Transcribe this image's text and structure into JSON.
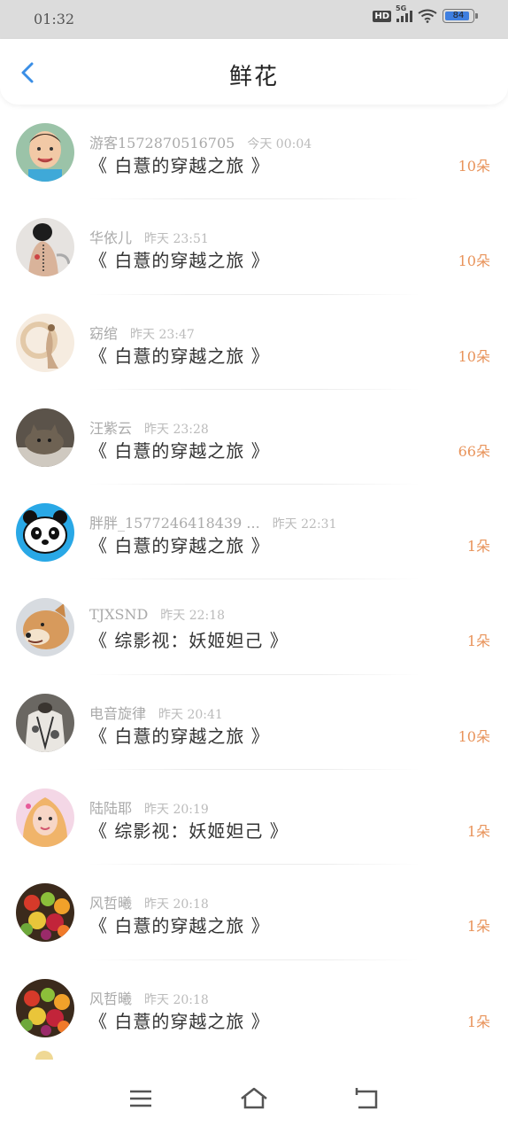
{
  "status_bar": {
    "time": "01:32",
    "hd": "HD",
    "network": "5G",
    "battery": "84"
  },
  "header": {
    "title": "鲜花"
  },
  "rows": [
    {
      "name": "游客1572870516705",
      "time": "今天 00:04",
      "book": "《 白薏的穿越之旅 》",
      "count": "10朵",
      "avatar": "avatar-child-photo"
    },
    {
      "name": "华依儿",
      "time": "昨天 23:51",
      "book": "《 白薏的穿越之旅 》",
      "count": "10朵",
      "avatar": "avatar-tattoo-photo"
    },
    {
      "name": "窈绾",
      "time": "昨天 23:47",
      "book": "《 白薏的穿越之旅 》",
      "count": "10朵",
      "avatar": "avatar-ink-painting"
    },
    {
      "name": "汪紫云",
      "time": "昨天 23:28",
      "book": "《 白薏的穿越之旅 》",
      "count": "66朵",
      "avatar": "avatar-cat-photo"
    },
    {
      "name": "胖胖_1577246418439 ...",
      "time": "昨天 22:31",
      "book": "《 白薏的穿越之旅 》",
      "count": "1朵",
      "avatar": "avatar-panda-cartoon"
    },
    {
      "name": "TJXSND",
      "time": "昨天 22:18",
      "book": "《 综影视：妖姬妲己 》",
      "count": "1朵",
      "avatar": "avatar-shiba-dog"
    },
    {
      "name": "电音旋律",
      "time": "昨天 20:41",
      "book": "《 白薏的穿越之旅 》",
      "count": "10朵",
      "avatar": "avatar-jacket-photo"
    },
    {
      "name": "陆陆耶",
      "time": "昨天 20:19",
      "book": "《 综影视：妖姬妲己 》",
      "count": "1朵",
      "avatar": "avatar-girl-photo"
    },
    {
      "name": "风哲曦",
      "time": "昨天 20:18",
      "book": "《 白薏的穿越之旅 》",
      "count": "1朵",
      "avatar": "avatar-fruit-photo"
    },
    {
      "name": "风哲曦",
      "time": "昨天 20:18",
      "book": "《 白薏的穿越之旅 》",
      "count": "1朵",
      "avatar": "avatar-fruit-photo"
    }
  ],
  "colors": {
    "accent": "#3a8ee6",
    "count": "#e8935a",
    "meta": "#aaaaaa"
  },
  "nav": {
    "menu_icon": "menu-icon",
    "home_icon": "home-icon",
    "back_icon": "back-icon"
  }
}
